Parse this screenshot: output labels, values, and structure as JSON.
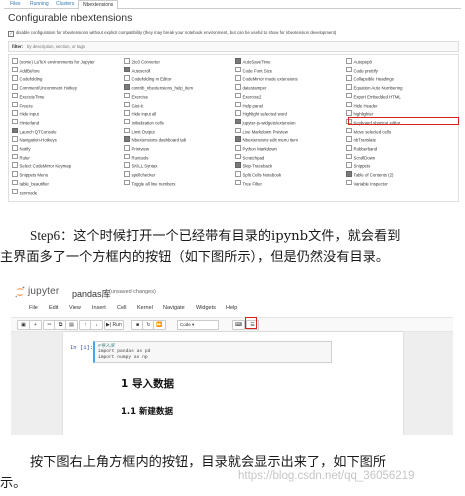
{
  "nbext": {
    "tabs": [
      "Files",
      "Running",
      "Clusters",
      "Nbextensions"
    ],
    "title": "Configurable nbextensions",
    "compat_label": "disable configuration for nbextensions without explicit compatibility (they may break your notebook environment, but can be useful to show for nbextension development)",
    "filter_label": "filter:",
    "filter_placeholder": "by description, section, or tags",
    "columns": [
      [
        {
          "label": "(some) LaTeX environments for Jupyter",
          "checked": false
        },
        {
          "label": "AddBefore",
          "checked": false
        },
        {
          "label": "Codefolding",
          "checked": false
        },
        {
          "label": "Comment/Uncomment Hotkey",
          "checked": false
        },
        {
          "label": "ExecuteTime",
          "checked": false
        },
        {
          "label": "Freeze",
          "checked": false
        },
        {
          "label": "Hide input",
          "checked": false
        },
        {
          "label": "Hinterland",
          "checked": false
        },
        {
          "label": "Launch QTConsole",
          "checked": true
        },
        {
          "label": "Navigation-Hotkeys",
          "checked": false
        },
        {
          "label": "Notify",
          "checked": false
        },
        {
          "label": "Ruler",
          "checked": false
        },
        {
          "label": "Select CodeMirror Keymap",
          "checked": false
        },
        {
          "label": "Snippets Menu",
          "checked": false
        },
        {
          "label": "table_beautifier",
          "checked": false
        },
        {
          "label": "zenmode",
          "checked": false
        }
      ],
      [
        {
          "label": "2to3 Converter",
          "checked": false
        },
        {
          "label": "Autoscroll",
          "checked": true
        },
        {
          "label": "Codefolding in Editor",
          "checked": false
        },
        {
          "label": "contrib_nbextensions_help_item",
          "checked": true
        },
        {
          "label": "Exercise",
          "checked": false
        },
        {
          "label": "Gist-it",
          "checked": false
        },
        {
          "label": "Hide input all",
          "checked": false
        },
        {
          "label": "Initialization cells",
          "checked": false
        },
        {
          "label": "Limit Output",
          "checked": false
        },
        {
          "label": "Nbextensions dashboard tab",
          "checked": true
        },
        {
          "label": "Printview",
          "checked": false
        },
        {
          "label": "Runtools",
          "checked": false
        },
        {
          "label": "SKILL Syntax",
          "checked": false
        },
        {
          "label": "spellchecker",
          "checked": false
        },
        {
          "label": "Toggle all line numbers",
          "checked": false
        }
      ],
      [
        {
          "label": "AutoSaveTime",
          "checked": true
        },
        {
          "label": "Code Font Size",
          "checked": false
        },
        {
          "label": "CodeMirror mode extensions",
          "checked": false
        },
        {
          "label": "datestamper",
          "checked": false
        },
        {
          "label": "Exercise2",
          "checked": false
        },
        {
          "label": "Help panel",
          "checked": false
        },
        {
          "label": "Highlight selected word",
          "checked": false
        },
        {
          "label": "jupyter-js-widgets/extension",
          "checked": true
        },
        {
          "label": "Live Markdown Preview",
          "checked": false
        },
        {
          "label": "Nbextensions edit menu item",
          "checked": true
        },
        {
          "label": "Python Markdown",
          "checked": false
        },
        {
          "label": "Scratchpad",
          "checked": false
        },
        {
          "label": "Skip-Traceback",
          "checked": true
        },
        {
          "label": "Split Cells Notebook",
          "checked": false
        },
        {
          "label": "Tree Filter",
          "checked": false
        }
      ],
      [
        {
          "label": "Autopep8",
          "checked": false
        },
        {
          "label": "Code prettify",
          "checked": false
        },
        {
          "label": "Collapsible Headings",
          "checked": false
        },
        {
          "label": "Equation Auto Numbering",
          "checked": false
        },
        {
          "label": "Export Embedded HTML",
          "checked": false
        },
        {
          "label": "Hide Header",
          "checked": false
        },
        {
          "label": "highlighter",
          "checked": false
        },
        {
          "label": "Keyboard shortcut editor",
          "checked": false
        },
        {
          "label": "Move selected cells",
          "checked": false
        },
        {
          "label": "nbTranslate",
          "checked": false
        },
        {
          "label": "Rubberband",
          "checked": false
        },
        {
          "label": "ScrollDown",
          "checked": false
        },
        {
          "label": "Snippets",
          "checked": false
        },
        {
          "label": "Table of Contents (2)",
          "checked": true
        },
        {
          "label": "Variable Inspector",
          "checked": false
        }
      ]
    ]
  },
  "paragraph1": {
    "step": "Step6",
    "line1_rest": "：这个时候打开一个已经带有目录的ipynb文件，就会看到",
    "line2": "主界面多了一个方框内的按钮（如下图所示），但是仍然没有目录。"
  },
  "jupyter": {
    "brand": "jupyter",
    "notebook_name": "pandas库",
    "status": "(unsaved changes)",
    "menu": [
      "File",
      "Edit",
      "View",
      "Insert",
      "Cell",
      "Kernel",
      "Navigate",
      "Widgets",
      "Help"
    ],
    "run_label": "Run",
    "cell_type": "Code",
    "prompt": "In [1]:",
    "code": [
      "#导入库",
      "import pandas as pd",
      "import numpy as np"
    ],
    "heading1": "1 导入数据",
    "heading2": "1.1 新建数据"
  },
  "paragraph2": {
    "line1": "按下图右上角方框内的按钮，目录就会显示出来了，如下图所",
    "line2": "示。"
  },
  "watermark": "https://blog.csdn.net/qq_36056219",
  "colors": {
    "highlight_box": "#d9221c",
    "link": "#337ab7",
    "prompt": "#303f9f"
  }
}
